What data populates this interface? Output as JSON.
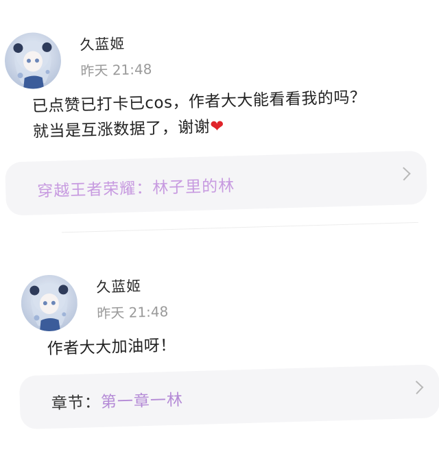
{
  "comments": [
    {
      "username": "久蓝姬",
      "time": "昨天 21:48",
      "text_line1": "已点赞已打卡已cos，作者大大能看看我的吗？",
      "text_line2": "就当是互涨数据了，谢谢",
      "heart": "❤",
      "link": {
        "text": "穿越王者荣耀：林子里的林"
      }
    },
    {
      "username": "久蓝姬",
      "time": "昨天 21:48",
      "text": "作者大大加油呀！",
      "link": {
        "prefix": "章节：",
        "value": "第一章一林"
      }
    }
  ],
  "colors": {
    "link_purple": "#b48ad6",
    "time_gray": "#9a9a9a",
    "card_bg": "#f5f5f7",
    "heart_red": "#e0242a"
  }
}
